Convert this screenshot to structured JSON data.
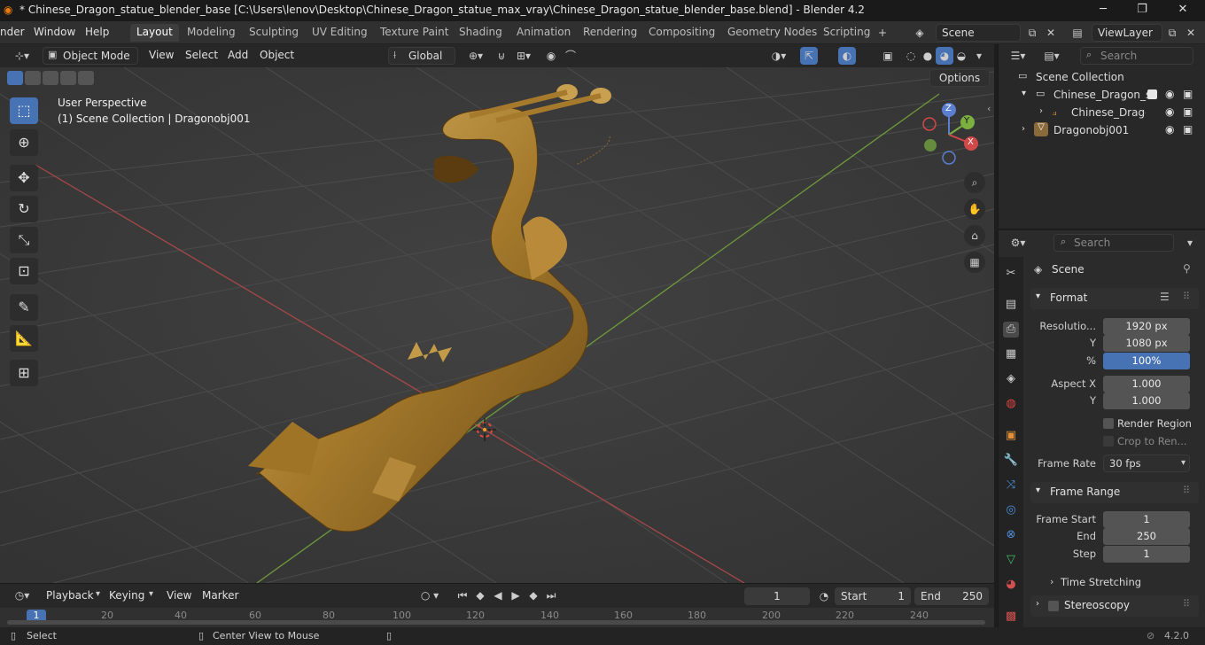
{
  "window": {
    "title": "* Chinese_Dragon_statue_blender_base [C:\\Users\\lenov\\Desktop\\Chinese_Dragon_statue_max_vray\\Chinese_Dragon_statue_blender_base.blend] - Blender 4.2",
    "minimize": "─",
    "maximize": "❐",
    "close": "✕"
  },
  "menu": [
    "nder",
    "Window",
    "Help"
  ],
  "workspaces": [
    "Layout",
    "Modeling",
    "Sculpting",
    "UV Editing",
    "Texture Paint",
    "Shading",
    "Animation",
    "Rendering",
    "Compositing",
    "Geometry Nodes",
    "Scripting"
  ],
  "active_workspace": "Layout",
  "scene_selector": "Scene",
  "viewlayer_selector": "ViewLayer",
  "viewport_header": {
    "mode": "Object Mode",
    "menus": [
      "View",
      "Select",
      "Add",
      "Object"
    ],
    "orientation": "Global",
    "options": "Options"
  },
  "viewport": {
    "perspective": "User Perspective",
    "collection_info": "(1) Scene Collection | Dragonobj001",
    "gizmo_x": "X",
    "gizmo_y": "Y",
    "gizmo_z": "Z"
  },
  "outliner": {
    "search_placeholder": "Search",
    "root": "Scene Collection",
    "items": [
      {
        "label": "Chinese_Dragon_st"
      },
      {
        "label": "Chinese_Drago"
      },
      {
        "label": "Dragonobj001"
      }
    ]
  },
  "properties": {
    "search_placeholder": "Search",
    "context": "Scene",
    "format_panel": "Format",
    "resolution_label": "Resolutio...",
    "res_x": "1920 px",
    "y_label": "Y",
    "res_y": "1080 px",
    "percent_label": "%",
    "percent": "100%",
    "aspect_label": "Aspect X",
    "aspect_x": "1.000",
    "aspect_y": "1.000",
    "render_region": "Render Region",
    "crop": "Crop to Ren...",
    "frame_rate_label": "Frame Rate",
    "frame_rate": "30 fps",
    "frame_range_panel": "Frame Range",
    "frame_start_label": "Frame Start",
    "frame_start": "1",
    "end_label": "End",
    "frame_end": "250",
    "step_label": "Step",
    "step": "1",
    "time_stretching": "Time Stretching",
    "stereoscopy": "Stereoscopy"
  },
  "timeline": {
    "menus": [
      "Playback",
      "Keying",
      "View",
      "Marker"
    ],
    "current_frame": "1",
    "start_label": "Start",
    "start": "1",
    "end_label": "End",
    "end": "250",
    "ruler": [
      "20",
      "40",
      "60",
      "80",
      "100",
      "120",
      "140",
      "160",
      "180",
      "200",
      "220",
      "240"
    ],
    "playhead": "1"
  },
  "status": {
    "select": "Select",
    "center": "Center View to Mouse",
    "version": "4.2.0"
  }
}
